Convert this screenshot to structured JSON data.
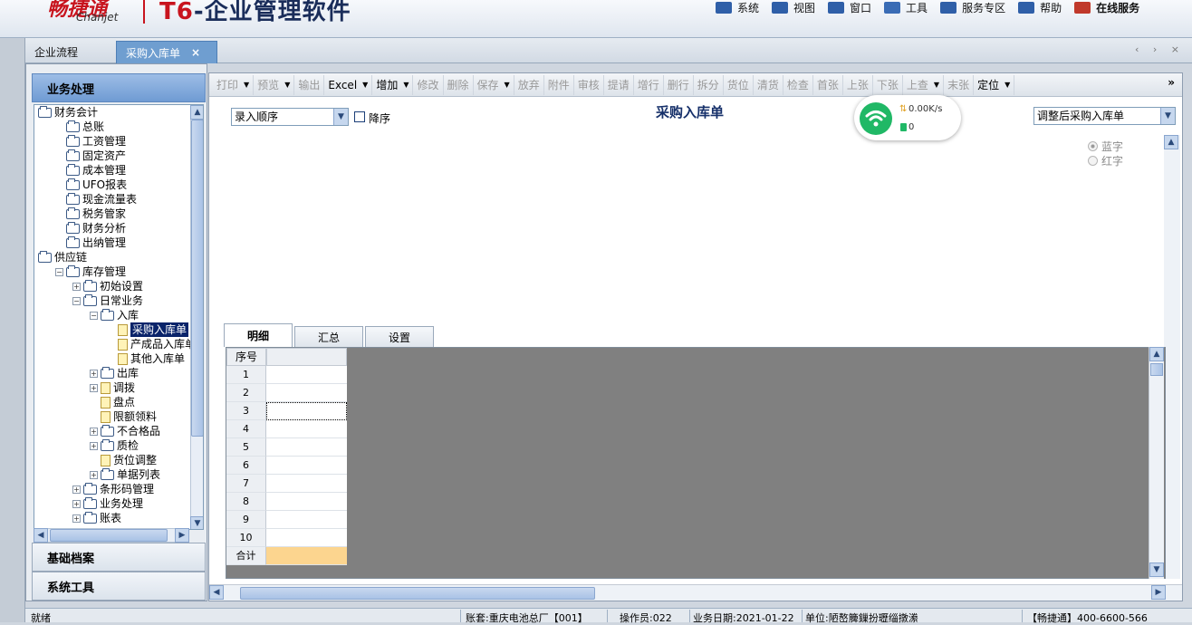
{
  "header": {
    "logo_cn": "畅捷通",
    "logo_en": "Chanjet",
    "product_prefix": "T6",
    "product_suffix": "-企业管理软件",
    "menu": [
      {
        "label": "系统",
        "icon": "system-icon"
      },
      {
        "label": "视图",
        "icon": "view-icon"
      },
      {
        "label": "窗口",
        "icon": "window-icon"
      },
      {
        "label": "工具",
        "icon": "tools-icon"
      },
      {
        "label": "服务专区",
        "icon": "service-icon"
      },
      {
        "label": "帮助",
        "icon": "help-icon"
      },
      {
        "label": "在线服务",
        "icon": "online-service-icon"
      }
    ]
  },
  "tabs": {
    "flow": "企业流程",
    "active": "采购入库单",
    "close": "×",
    "controls": "‹ › ×"
  },
  "left": {
    "title": "业务处理",
    "bottom_buttons": [
      "基础档案",
      "系统工具"
    ]
  },
  "tree": [
    {
      "label": "财务会计",
      "indent": 0,
      "pm": "",
      "type": "folder"
    },
    {
      "label": "总账",
      "indent": 1,
      "pm": "",
      "type": "folder"
    },
    {
      "label": "工资管理",
      "indent": 1,
      "pm": "",
      "type": "folder"
    },
    {
      "label": "固定资产",
      "indent": 1,
      "pm": "",
      "type": "folder"
    },
    {
      "label": "成本管理",
      "indent": 1,
      "pm": "",
      "type": "folder"
    },
    {
      "label": "UFO报表",
      "indent": 1,
      "pm": "",
      "type": "folder"
    },
    {
      "label": "现金流量表",
      "indent": 1,
      "pm": "",
      "type": "folder"
    },
    {
      "label": "税务管家",
      "indent": 1,
      "pm": "",
      "type": "folder"
    },
    {
      "label": "财务分析",
      "indent": 1,
      "pm": "",
      "type": "folder"
    },
    {
      "label": "出纳管理",
      "indent": 1,
      "pm": "",
      "type": "folder"
    },
    {
      "label": "供应链",
      "indent": 0,
      "pm": "",
      "type": "folder"
    },
    {
      "label": "库存管理",
      "indent": 1,
      "pm": "-",
      "type": "folder"
    },
    {
      "label": "初始设置",
      "indent": 2,
      "pm": "+",
      "type": "folder"
    },
    {
      "label": "日常业务",
      "indent": 2,
      "pm": "-",
      "type": "folder"
    },
    {
      "label": "入库",
      "indent": 3,
      "pm": "-",
      "type": "folder"
    },
    {
      "label": "采购入库单",
      "indent": 4,
      "pm": "",
      "type": "doc",
      "selected": true
    },
    {
      "label": "产成品入库单",
      "indent": 4,
      "pm": "",
      "type": "doc"
    },
    {
      "label": "其他入库单",
      "indent": 4,
      "pm": "",
      "type": "doc"
    },
    {
      "label": "出库",
      "indent": 3,
      "pm": "+",
      "type": "folder"
    },
    {
      "label": "调拨",
      "indent": 3,
      "pm": "+",
      "type": "doc"
    },
    {
      "label": "盘点",
      "indent": 3,
      "pm": "",
      "type": "doc"
    },
    {
      "label": "限额领料",
      "indent": 3,
      "pm": "",
      "type": "doc"
    },
    {
      "label": "不合格品",
      "indent": 3,
      "pm": "+",
      "type": "folder"
    },
    {
      "label": "质检",
      "indent": 3,
      "pm": "+",
      "type": "folder"
    },
    {
      "label": "货位调整",
      "indent": 3,
      "pm": "",
      "type": "doc"
    },
    {
      "label": "单据列表",
      "indent": 3,
      "pm": "+",
      "type": "folder"
    },
    {
      "label": "条形码管理",
      "indent": 2,
      "pm": "+",
      "type": "folder"
    },
    {
      "label": "业务处理",
      "indent": 2,
      "pm": "+",
      "type": "folder"
    },
    {
      "label": "账表",
      "indent": 2,
      "pm": "+",
      "type": "folder"
    }
  ],
  "toolbar": [
    {
      "label": "打印",
      "enabled": false,
      "dropdown": true
    },
    {
      "label": "预览",
      "enabled": false,
      "dropdown": true
    },
    {
      "label": "输出",
      "enabled": false,
      "dropdown": false
    },
    {
      "label": "Excel",
      "enabled": true,
      "dropdown": true
    },
    {
      "label": "增加",
      "enabled": true,
      "dropdown": true
    },
    {
      "label": "修改",
      "enabled": false,
      "dropdown": false
    },
    {
      "label": "删除",
      "enabled": false,
      "dropdown": false
    },
    {
      "label": "保存",
      "enabled": false,
      "dropdown": true
    },
    {
      "label": "放弃",
      "enabled": false,
      "dropdown": false
    },
    {
      "label": "附件",
      "enabled": false,
      "dropdown": false
    },
    {
      "label": "审核",
      "enabled": false,
      "dropdown": false
    },
    {
      "label": "提请",
      "enabled": false,
      "dropdown": false
    },
    {
      "label": "增行",
      "enabled": false,
      "dropdown": false
    },
    {
      "label": "删行",
      "enabled": false,
      "dropdown": false
    },
    {
      "label": "拆分",
      "enabled": false,
      "dropdown": false
    },
    {
      "label": "货位",
      "enabled": false,
      "dropdown": false
    },
    {
      "label": "清货",
      "enabled": false,
      "dropdown": false
    },
    {
      "label": "检查",
      "enabled": false,
      "dropdown": false
    },
    {
      "label": "首张",
      "enabled": false,
      "dropdown": false
    },
    {
      "label": "上张",
      "enabled": false,
      "dropdown": false
    },
    {
      "label": "下张",
      "enabled": false,
      "dropdown": false
    },
    {
      "label": "上查",
      "enabled": false,
      "dropdown": true
    },
    {
      "label": "末张",
      "enabled": false,
      "dropdown": false
    },
    {
      "label": "定位",
      "enabled": true,
      "dropdown": true
    }
  ],
  "toolbar_more": "»",
  "form": {
    "order_select": "录入顺序",
    "desc_label": "降序",
    "title": "采购入库单",
    "type_select": "调整后采购入库单",
    "radio_blue": "蓝字",
    "radio_red": "红字"
  },
  "network": {
    "speed": "0.00K/s",
    "count": "0"
  },
  "detail_tabs": [
    "明细",
    "汇总",
    "设置"
  ],
  "grid": {
    "header_no": "序号",
    "rows": [
      "1",
      "2",
      "3",
      "4",
      "5",
      "6",
      "7",
      "8",
      "9",
      "10"
    ],
    "sum_label": "合计"
  },
  "status": {
    "ready": "就绪",
    "account": "账套:重庆电池总厂【001】",
    "operator": "操作员:022",
    "biz_date": "业务日期:2021-01-22",
    "unit": "单位:陋嶅簲鏁扮瓑缁撴潫",
    "hotline": "【畅捷通】400-6600-566"
  },
  "colors": {
    "accent": "#6f9ed0",
    "logo_red": "#c8141e",
    "sum_cell": "#fcd58f",
    "grid_bg": "#808080"
  }
}
